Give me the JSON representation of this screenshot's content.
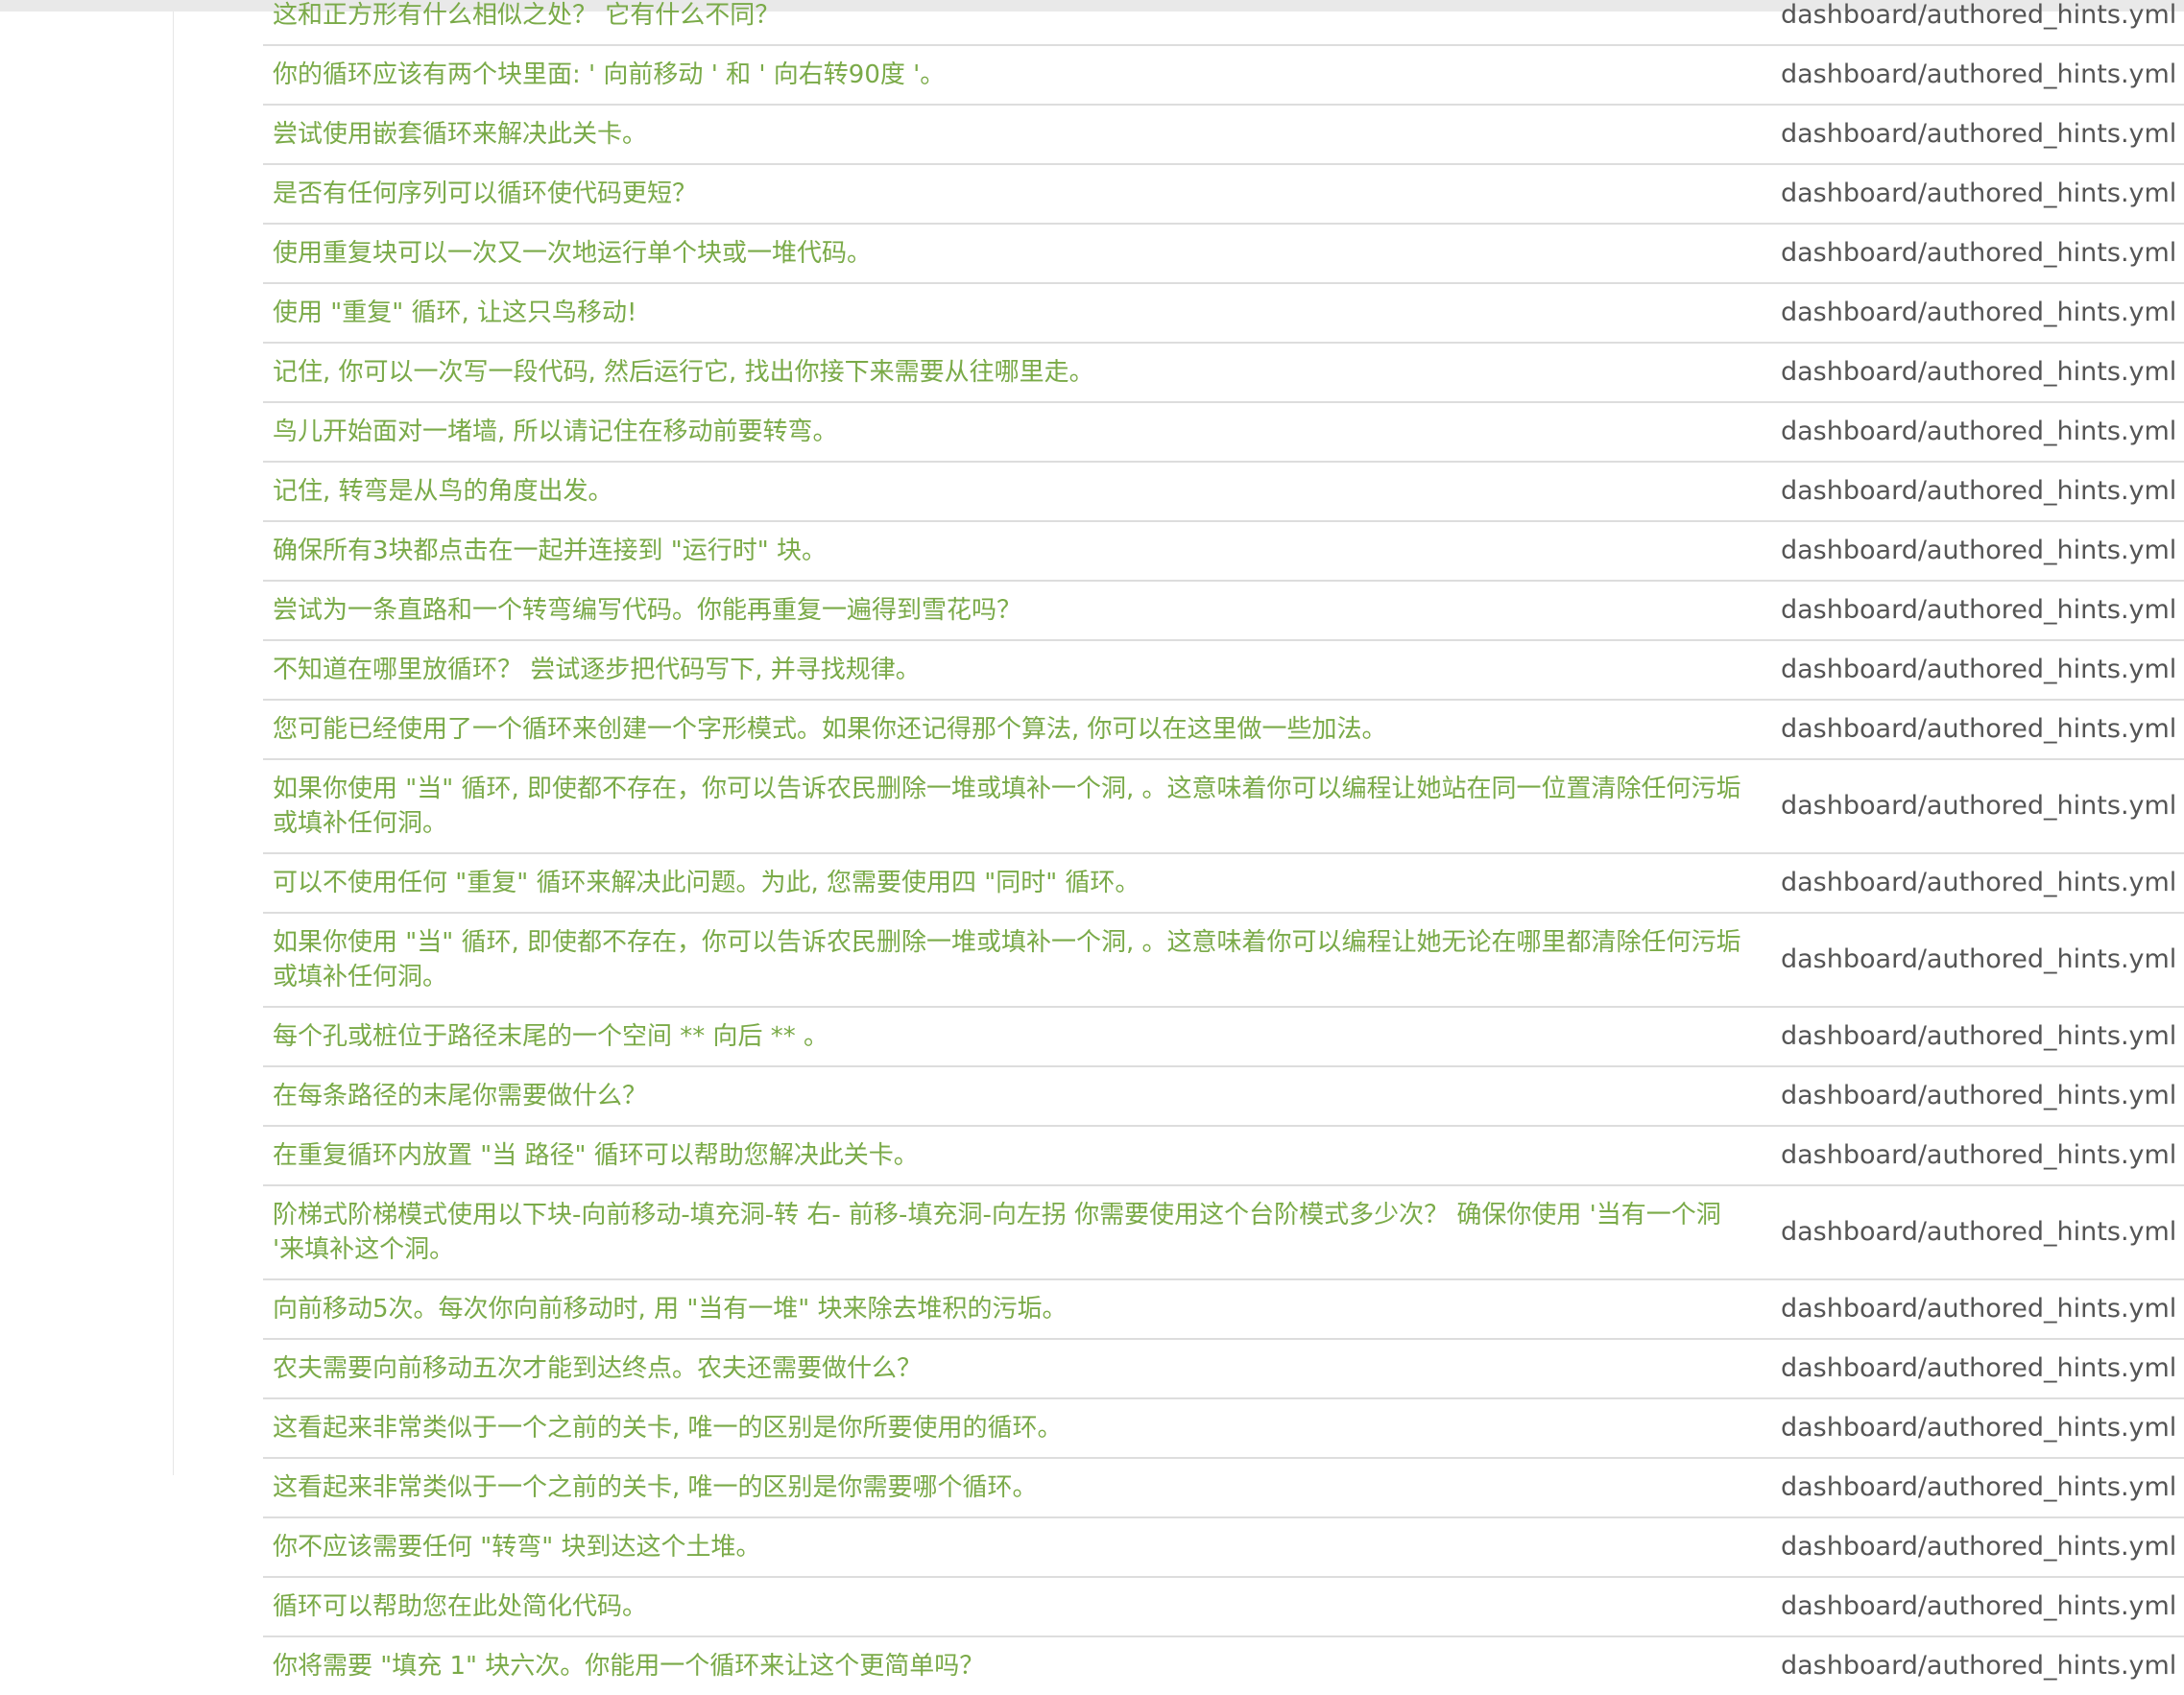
{
  "rows": [
    {
      "text": "这和正方形有什么相似之处？ 它有什么不同？",
      "file": "dashboard/authored_hints.yml"
    },
    {
      "text": "你的循环应该有两个块里面: ' 向前移动 ' 和 ' 向右转90度 '。",
      "file": "dashboard/authored_hints.yml"
    },
    {
      "text": "尝试使用嵌套循环来解决此关卡。",
      "file": "dashboard/authored_hints.yml"
    },
    {
      "text": "是否有任何序列可以循环使代码更短？",
      "file": "dashboard/authored_hints.yml"
    },
    {
      "text": "使用重复块可以一次又一次地运行单个块或一堆代码。",
      "file": "dashboard/authored_hints.yml"
    },
    {
      "text": "使用 \"重复\" 循环, 让这只鸟移动!",
      "file": "dashboard/authored_hints.yml"
    },
    {
      "text": "记住, 你可以一次写一段代码, 然后运行它, 找出你接下来需要从往哪里走。",
      "file": "dashboard/authored_hints.yml"
    },
    {
      "text": "鸟儿开始面对一堵墙, 所以请记住在移动前要转弯。",
      "file": "dashboard/authored_hints.yml"
    },
    {
      "text": "记住, 转弯是从鸟的角度出发。",
      "file": "dashboard/authored_hints.yml"
    },
    {
      "text": "确保所有3块都点击在一起并连接到 \"运行时\" 块。",
      "file": "dashboard/authored_hints.yml"
    },
    {
      "text": "尝试为一条直路和一个转弯编写代码。你能再重复一遍得到雪花吗？",
      "file": "dashboard/authored_hints.yml"
    },
    {
      "text": "不知道在哪里放循环？ 尝试逐步把代码写下, 并寻找规律。",
      "file": "dashboard/authored_hints.yml"
    },
    {
      "text": "您可能已经使用了一个循环来创建一个字形模式。如果你还记得那个算法, 你可以在这里做一些加法。",
      "file": "dashboard/authored_hints.yml"
    },
    {
      "text": "如果你使用 \"当\" 循环, 即使都不存在，你可以告诉农民删除一堆或填补一个洞, 。这意味着你可以编程让她站在同一位置清除任何污垢或填补任何洞。",
      "file": "dashboard/authored_hints.yml"
    },
    {
      "text": "可以不使用任何 \"重复\" 循环来解决此问题。为此, 您需要使用四 \"同时\" 循环。",
      "file": "dashboard/authored_hints.yml"
    },
    {
      "text": "如果你使用 \"当\" 循环, 即使都不存在，你可以告诉农民删除一堆或填补一个洞, 。这意味着你可以编程让她无论在哪里都清除任何污垢或填补任何洞。",
      "file": "dashboard/authored_hints.yml"
    },
    {
      "text": "每个孔或桩位于路径末尾的一个空间 ** 向后 ** 。",
      "file": "dashboard/authored_hints.yml"
    },
    {
      "text": "在每条路径的末尾你需要做什么？",
      "file": "dashboard/authored_hints.yml"
    },
    {
      "text": "在重复循环内放置 \"当 路径\" 循环可以帮助您解决此关卡。",
      "file": "dashboard/authored_hints.yml"
    },
    {
      "text": "阶梯式阶梯模式使用以下块-向前移动-填充洞-转 右- 前移-填充洞-向左拐 你需要使用这个台阶模式多少次？ 确保你使用 '当有一个洞 '来填补这个洞。",
      "file": "dashboard/authored_hints.yml"
    },
    {
      "text": "向前移动5次。每次你向前移动时, 用 \"当有一堆\" 块来除去堆积的污垢。",
      "file": "dashboard/authored_hints.yml"
    },
    {
      "text": "农夫需要向前移动五次才能到达终点。农夫还需要做什么？",
      "file": "dashboard/authored_hints.yml"
    },
    {
      "text": "这看起来非常类似于一个之前的关卡, 唯一的区别是你所要使用的循环。",
      "file": "dashboard/authored_hints.yml"
    },
    {
      "text": "这看起来非常类似于一个之前的关卡, 唯一的区别是你需要哪个循环。",
      "file": "dashboard/authored_hints.yml"
    },
    {
      "text": "你不应该需要任何 \"转弯\" 块到达这个土堆。",
      "file": "dashboard/authored_hints.yml"
    },
    {
      "text": "循环可以帮助您在此处简化代码。",
      "file": "dashboard/authored_hints.yml"
    },
    {
      "text": "你将需要 \"填充 1\" 块六次。你能用一个循环来让这个更简单吗？",
      "file": "dashboard/authored_hints.yml"
    }
  ],
  "colors": {
    "link": "#7aaa48",
    "file": "#555555",
    "divider": "#dddddd"
  }
}
